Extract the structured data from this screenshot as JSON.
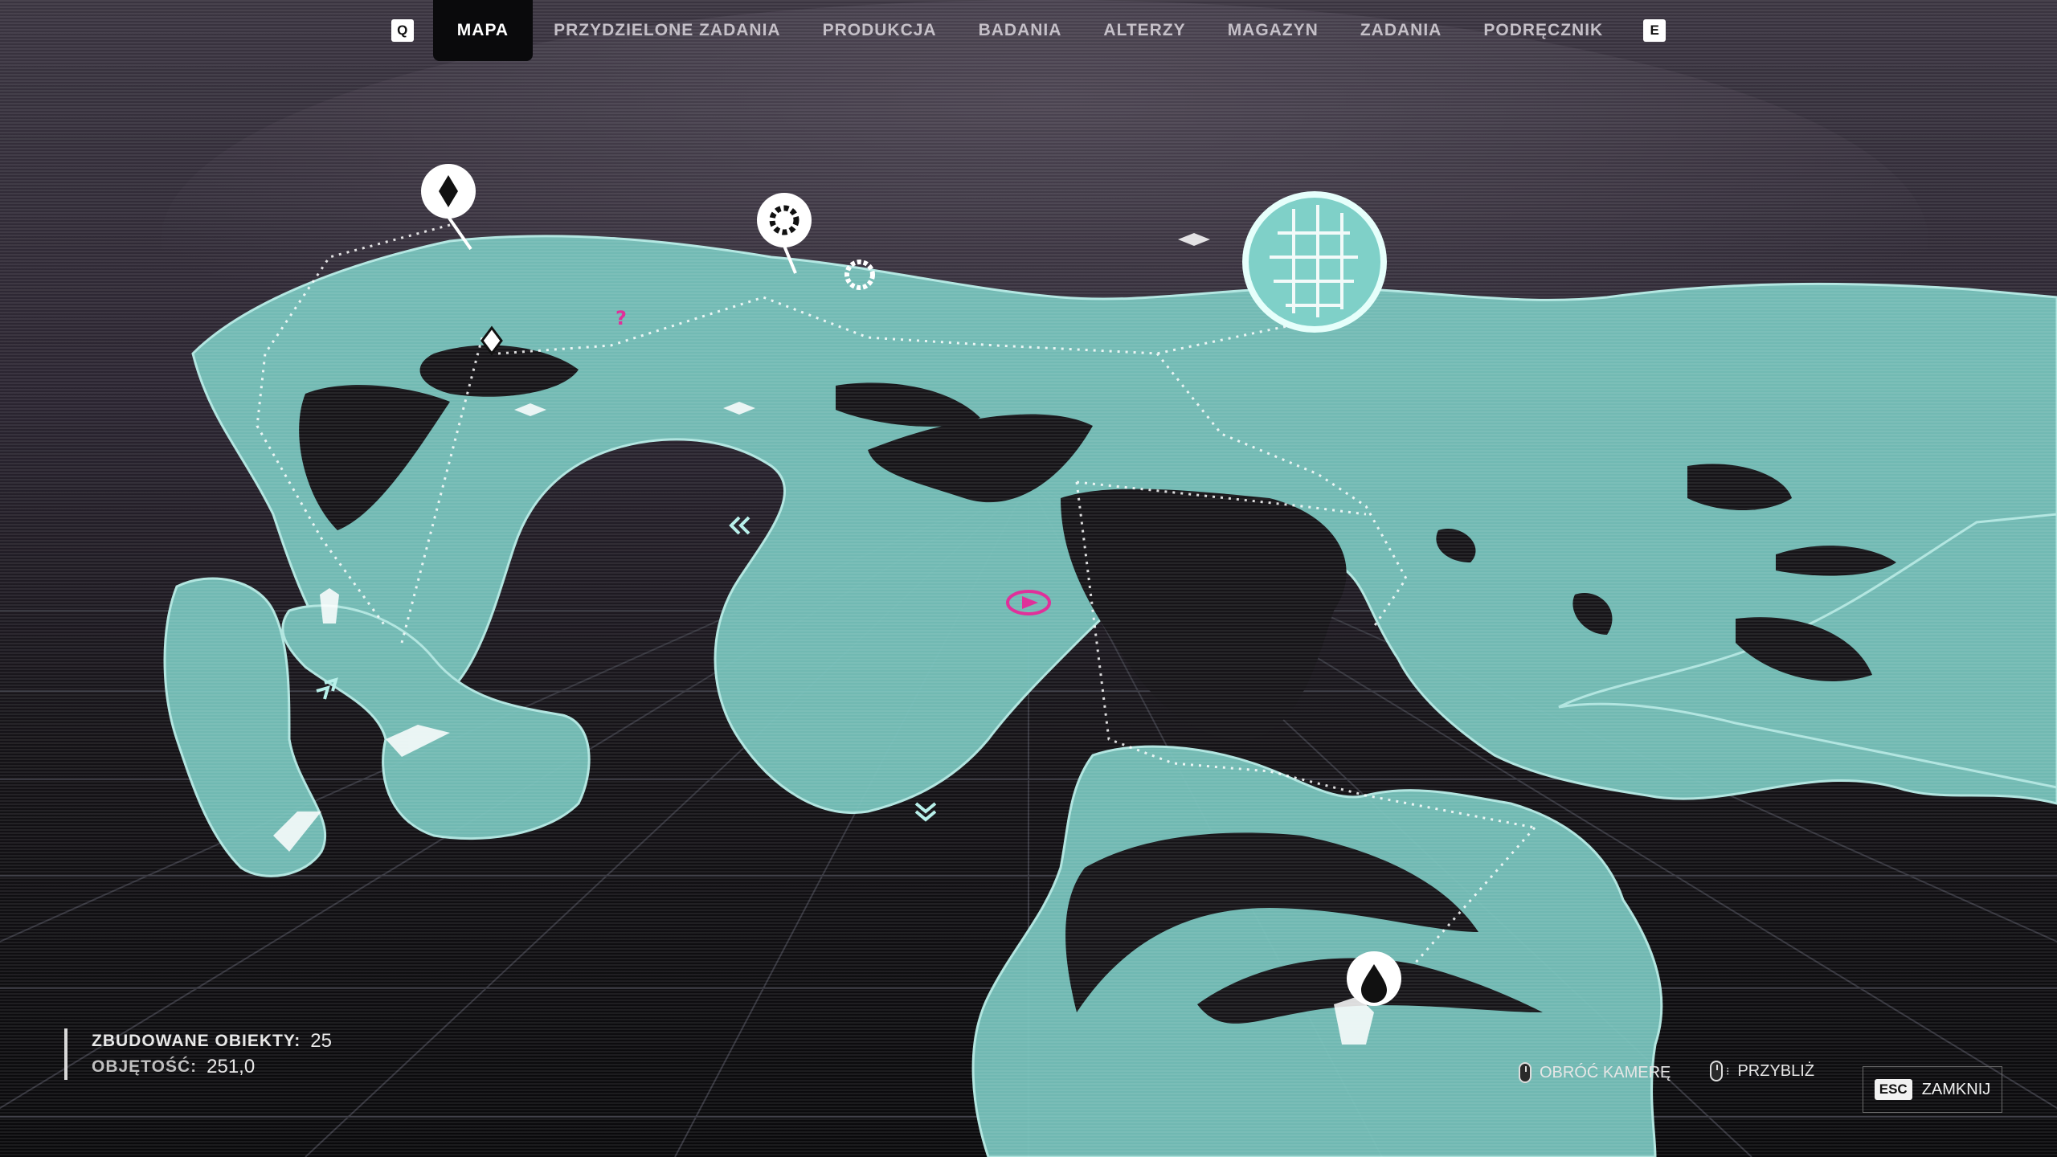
{
  "nav": {
    "prev_key": "Q",
    "next_key": "E",
    "tabs": [
      {
        "label": "MAPA",
        "active": true
      },
      {
        "label": "PRZYDZIELONE ZADANIA",
        "active": false
      },
      {
        "label": "PRODUKCJA",
        "active": false
      },
      {
        "label": "BADANIA",
        "active": false
      },
      {
        "label": "ALTERZY",
        "active": false
      },
      {
        "label": "MAGAZYN",
        "active": false
      },
      {
        "label": "ZADANIA",
        "active": false
      },
      {
        "label": "PODRĘCZNIK",
        "active": false
      }
    ]
  },
  "stats": {
    "built_label": "ZBUDOWANE OBIEKTY:",
    "built_value": "25",
    "volume_label": "OBJĘTOŚĆ:",
    "volume_value": "251,0"
  },
  "controls": {
    "rotate_label": "OBRÓĆ KAMERĘ",
    "zoom_label": "PRZYBLIŻ",
    "close_key": "ESC",
    "close_label": "ZAMKNIJ"
  },
  "colors": {
    "land": "#7cc7c0",
    "land_edge": "#b8f0ea",
    "sky": "#2c2630",
    "grid": "#2f2f36",
    "marker": "#ffffff",
    "player": "#e0309a"
  },
  "icons": [
    "diamond-marker-icon",
    "gear-marker-icon",
    "water-drop-marker-icon",
    "base-dome-icon",
    "player-location-icon",
    "question-mark-icon"
  ]
}
